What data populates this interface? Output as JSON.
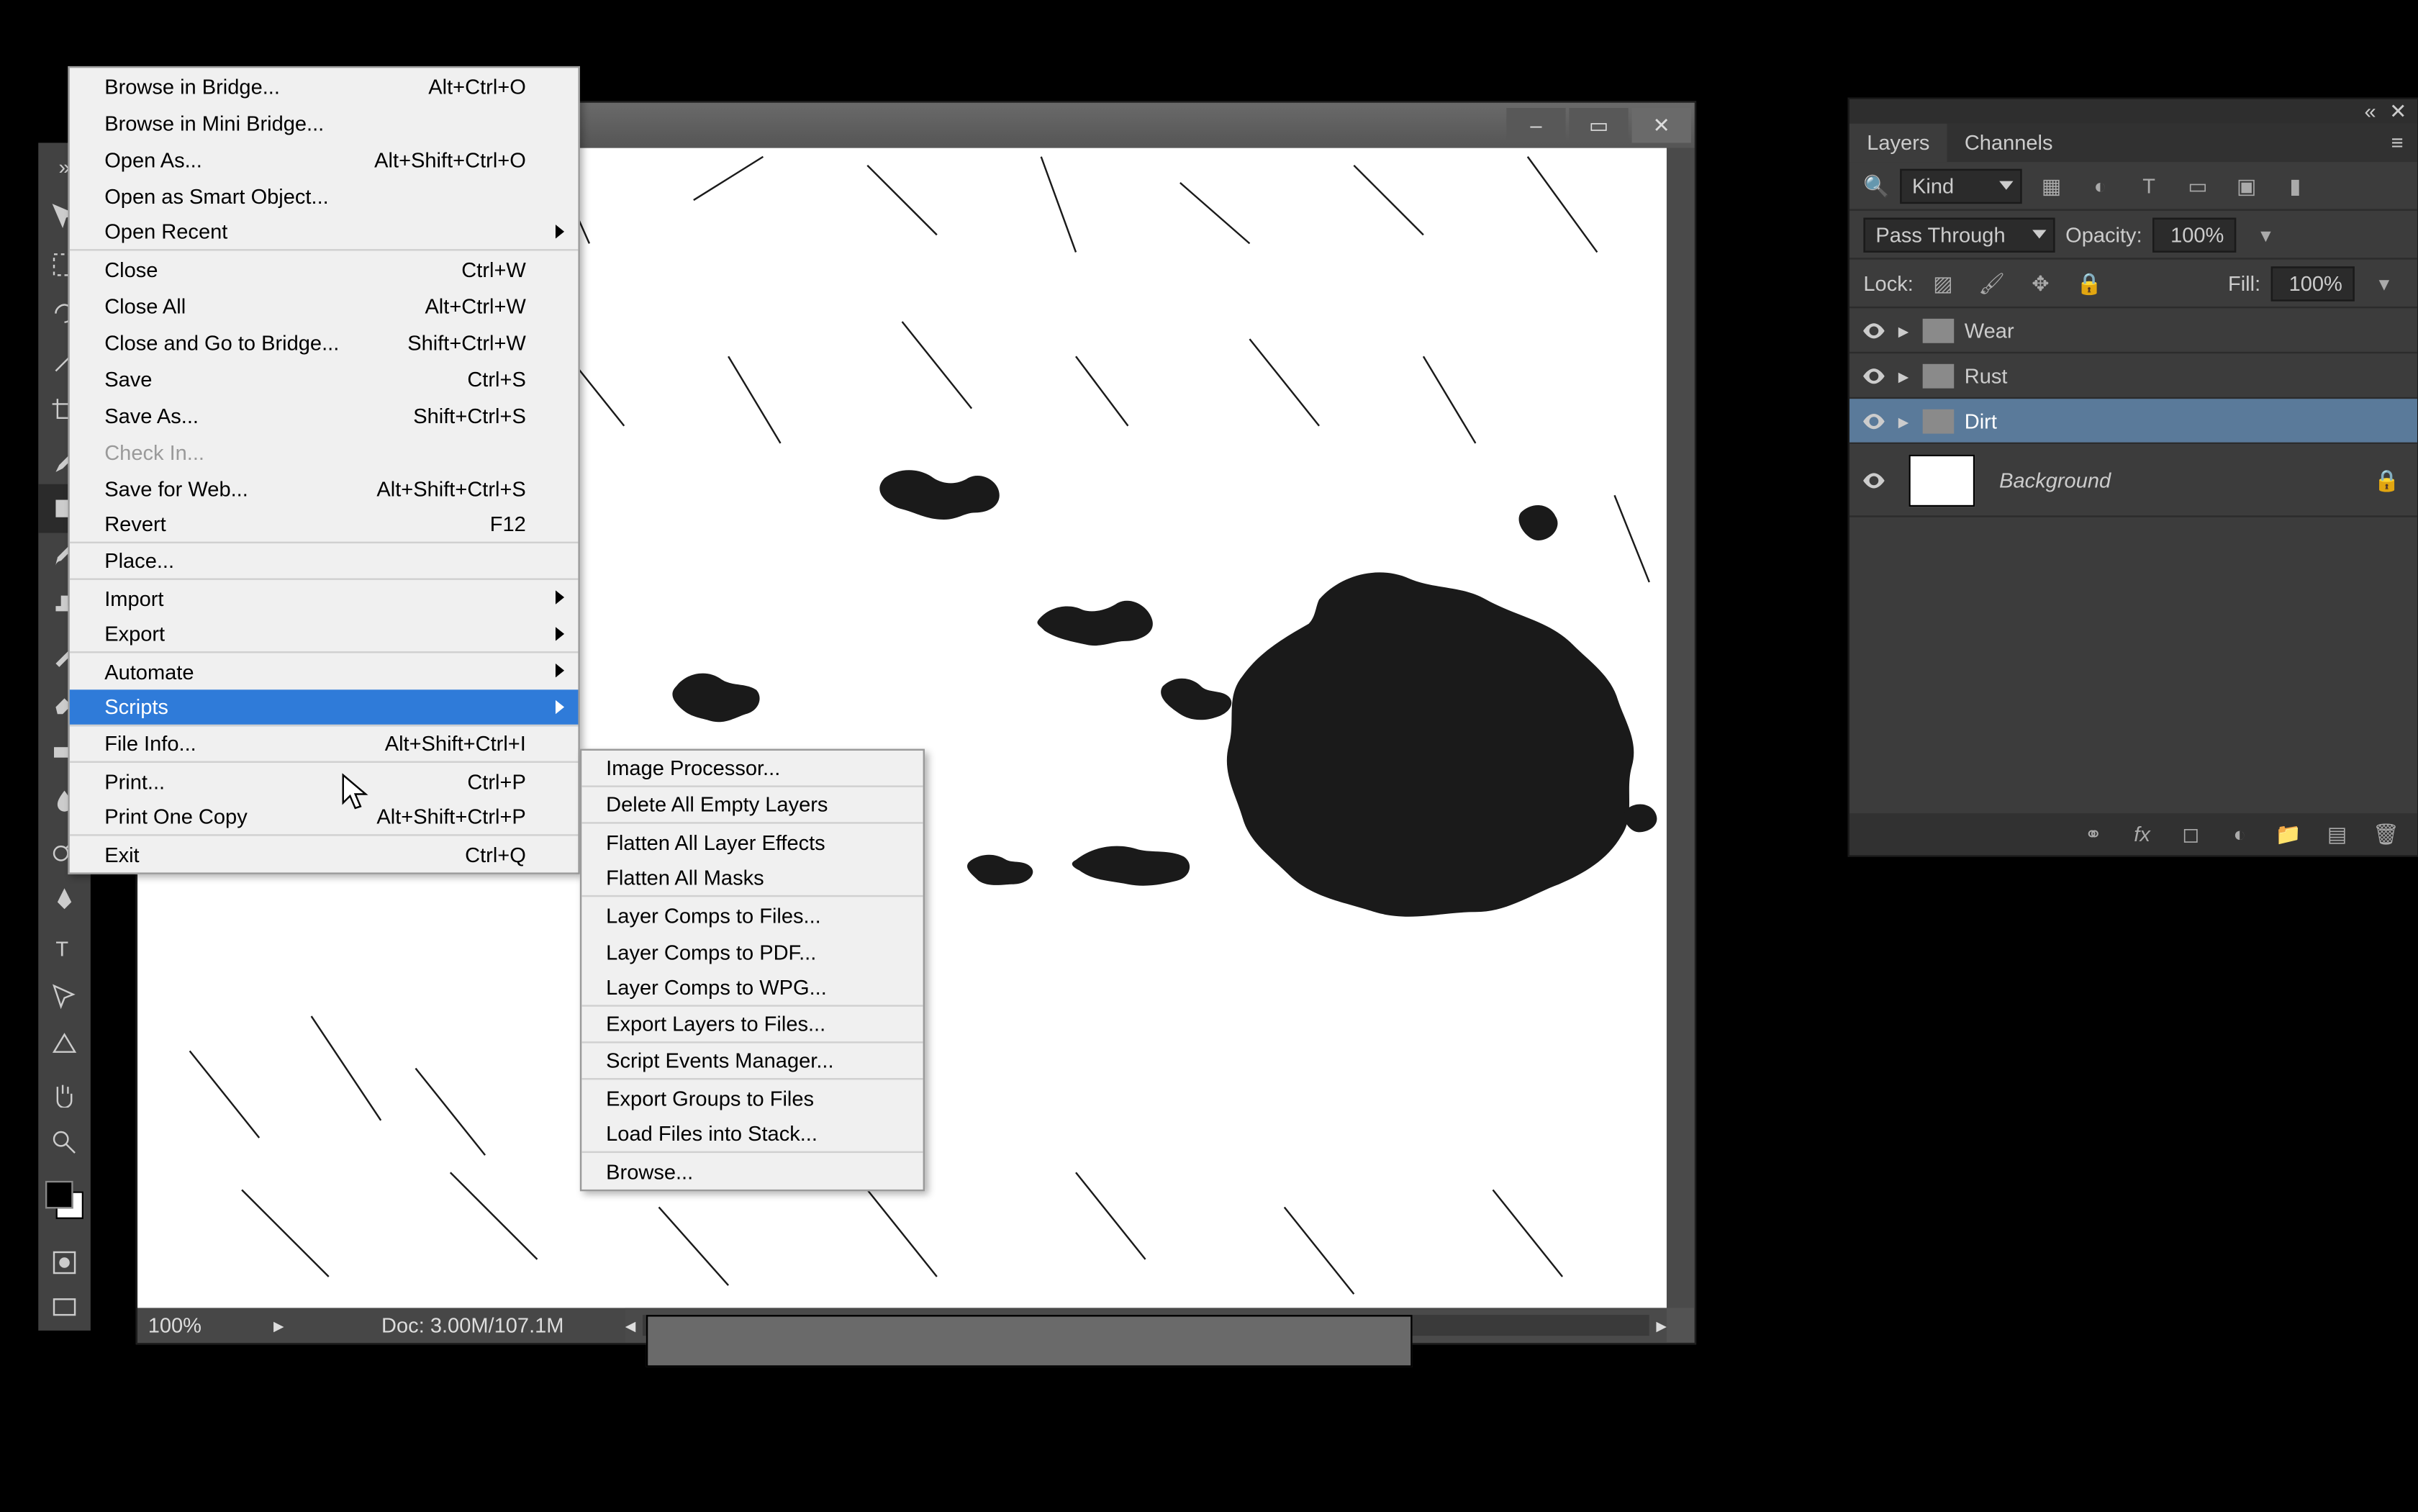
{
  "doc_window": {
    "minimize": "–",
    "maximize": "▭",
    "close": "✕"
  },
  "statusbar": {
    "zoom": "100%",
    "doc": "Doc: 3.00M/107.1M"
  },
  "file_menu": [
    {
      "label": "Browse in Bridge...",
      "shortcut": "Alt+Ctrl+O"
    },
    {
      "label": "Browse in Mini Bridge..."
    },
    {
      "label": "Open As...",
      "shortcut": "Alt+Shift+Ctrl+O"
    },
    {
      "label": "Open as Smart Object..."
    },
    {
      "label": "Open Recent",
      "submenu": true,
      "sep": true
    },
    {
      "label": "Close",
      "shortcut": "Ctrl+W"
    },
    {
      "label": "Close All",
      "shortcut": "Alt+Ctrl+W"
    },
    {
      "label": "Close and Go to Bridge...",
      "shortcut": "Shift+Ctrl+W"
    },
    {
      "label": "Save",
      "shortcut": "Ctrl+S"
    },
    {
      "label": "Save As...",
      "shortcut": "Shift+Ctrl+S"
    },
    {
      "label": "Check In...",
      "disabled": true
    },
    {
      "label": "Save for Web...",
      "shortcut": "Alt+Shift+Ctrl+S"
    },
    {
      "label": "Revert",
      "shortcut": "F12",
      "sep": true
    },
    {
      "label": "Place...",
      "sep": true
    },
    {
      "label": "Import",
      "submenu": true
    },
    {
      "label": "Export",
      "submenu": true,
      "sep": true
    },
    {
      "label": "Automate",
      "submenu": true
    },
    {
      "label": "Scripts",
      "submenu": true,
      "highlight": true,
      "sep": true
    },
    {
      "label": "File Info...",
      "shortcut": "Alt+Shift+Ctrl+I",
      "sep": true
    },
    {
      "label": "Print...",
      "shortcut": "Ctrl+P"
    },
    {
      "label": "Print One Copy",
      "shortcut": "Alt+Shift+Ctrl+P",
      "sep": true
    },
    {
      "label": "Exit",
      "shortcut": "Ctrl+Q"
    }
  ],
  "scripts_submenu": [
    {
      "label": "Image Processor...",
      "sep": true
    },
    {
      "label": "Delete All Empty Layers",
      "sep": true
    },
    {
      "label": "Flatten All Layer Effects"
    },
    {
      "label": "Flatten All Masks",
      "sep": true
    },
    {
      "label": "Layer Comps to Files..."
    },
    {
      "label": "Layer Comps to PDF..."
    },
    {
      "label": "Layer Comps to WPG...",
      "sep": true
    },
    {
      "label": "Export Layers to Files...",
      "sep": true
    },
    {
      "label": "Script Events Manager...",
      "sep": true
    },
    {
      "label": "Export Groups to Files"
    },
    {
      "label": "Load Files into Stack...",
      "sep": true
    },
    {
      "label": "Browse..."
    }
  ],
  "layers_panel": {
    "tabs": [
      "Layers",
      "Channels"
    ],
    "kind_label": "Kind",
    "blend_mode": "Pass Through",
    "opacity_label": "Opacity:",
    "opacity_value": "100%",
    "lock_label": "Lock:",
    "fill_label": "Fill:",
    "fill_value": "100%",
    "layers": [
      {
        "name": "Wear",
        "type": "group"
      },
      {
        "name": "Rust",
        "type": "group"
      },
      {
        "name": "Dirt",
        "type": "group",
        "selected": true
      },
      {
        "name": "Background",
        "type": "bg"
      }
    ]
  }
}
